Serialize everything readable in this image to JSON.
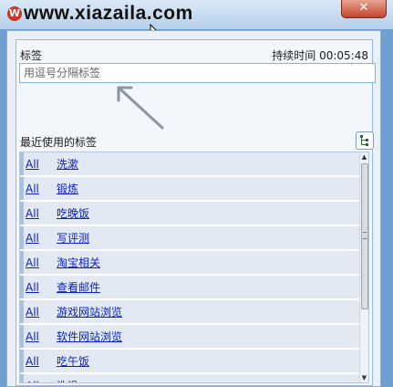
{
  "window": {
    "watermark": "www.xiazaila.com",
    "close_label": "✕"
  },
  "form": {
    "tags_label": "标签",
    "duration_text": "持续时间 00:05:48",
    "tags_placeholder": "用逗号分隔标签"
  },
  "recent": {
    "label": "最近使用的标签",
    "all_label": "All",
    "items": [
      "洗漱",
      "锻炼",
      "吃晚饭",
      "写评测",
      "淘宝相关",
      "查看邮件",
      "游戏网站浏览",
      "软件网站浏览",
      "吃午饭",
      "洗澡"
    ]
  }
}
